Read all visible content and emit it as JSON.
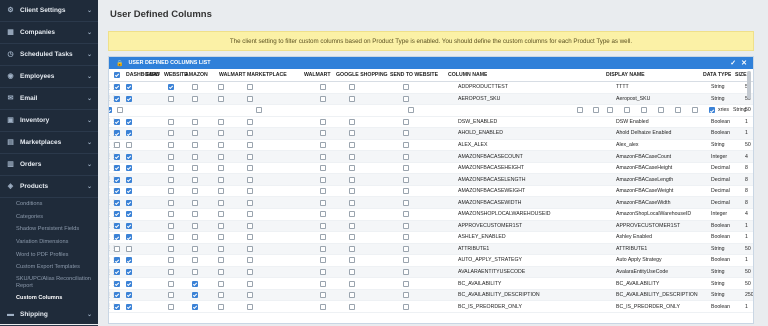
{
  "sidebar": {
    "top_items": [
      {
        "label": "Client Settings",
        "icon": "gear-icon",
        "glyph": "⚙"
      },
      {
        "label": "Companies",
        "icon": "building-icon",
        "glyph": "▦"
      },
      {
        "label": "Scheduled Tasks",
        "icon": "clock-icon",
        "glyph": "◷"
      },
      {
        "label": "Employees",
        "icon": "users-icon",
        "glyph": "◉"
      },
      {
        "label": "Email",
        "icon": "envelope-icon",
        "glyph": "✉"
      },
      {
        "label": "Inventory",
        "icon": "box-icon",
        "glyph": "▣"
      },
      {
        "label": "Marketplaces",
        "icon": "store-icon",
        "glyph": "▤"
      },
      {
        "label": "Orders",
        "icon": "cart-icon",
        "glyph": "▥"
      },
      {
        "label": "Products",
        "icon": "tag-icon",
        "glyph": "◈"
      }
    ],
    "sub_items": [
      "Conditions",
      "Categories",
      "Shadow Persistent Fields",
      "Variation Dimensions",
      "Word to PDF Profiles",
      "Custom Export Templates",
      "SKU/UPC/Alias Reconciliation Report",
      "Custom Columns"
    ],
    "bottom_item": {
      "label": "Shipping",
      "icon": "truck-icon",
      "glyph": "▬"
    }
  },
  "page": {
    "title": "User Defined Columns",
    "warning": "The client setting to filter custom columns based on Product Type is enabled. You should define the custom columns for each Product Type as well."
  },
  "panel": {
    "title": "USER DEFINED COLUMNS LIST",
    "save_glyph": "✓",
    "close_glyph": "✕",
    "lock_glyph": "🔒"
  },
  "columns": [
    "DASHBOARD",
    "EBAY",
    "WEBSITE",
    "AMAZON",
    "WALMART MARKETPLACE",
    "WALMART",
    "GOOGLE SHOPPING",
    "SEND TO WEBSITE",
    "COLUMN NAME",
    "DISPLAY NAME",
    "DATA TYPE",
    "SIZE"
  ],
  "editing_row": {
    "data_type": "xries",
    "type_label": "String",
    "size": "50"
  },
  "rows": [
    {
      "sel": true,
      "flags": [
        1,
        1,
        0,
        0,
        0,
        0,
        0,
        0
      ],
      "name": "ADDPRODUCTTEST",
      "display": "TTTT",
      "type": "String",
      "size": "50"
    },
    {
      "sel": true,
      "flags": [
        1,
        0,
        0,
        0,
        0,
        0,
        0,
        0
      ],
      "name": "AEROPOST_SKU",
      "display": "Aeropost_SKU",
      "type": "String",
      "size": "50"
    },
    {
      "sel": true,
      "flags": [
        1,
        0,
        0,
        0,
        0,
        0,
        0,
        0
      ],
      "name": "DSW_ENABLED",
      "display": "DSW Enabled",
      "type": "Boolean",
      "size": "1"
    },
    {
      "sel": true,
      "flags": [
        1,
        0,
        0,
        0,
        0,
        0,
        0,
        0
      ],
      "name": "AHOLD_ENABLED",
      "display": "Ahold Delhaize Enabled",
      "type": "Boolean",
      "size": "1"
    },
    {
      "sel": false,
      "flags": [
        0,
        0,
        0,
        0,
        0,
        0,
        0,
        0
      ],
      "name": "ALEX_ALEX",
      "display": "Alex_alex",
      "type": "String",
      "size": "50"
    },
    {
      "sel": true,
      "flags": [
        1,
        0,
        0,
        0,
        0,
        0,
        0,
        0
      ],
      "name": "AMAZONFBACASECOUNT",
      "display": "AmazonFBACaseCount",
      "type": "Integer",
      "size": "4"
    },
    {
      "sel": true,
      "flags": [
        1,
        0,
        0,
        0,
        0,
        0,
        0,
        0
      ],
      "name": "AMAZONFBACASEHEIGHT",
      "display": "AmazonFBACaseHeight",
      "type": "Decimal",
      "size": "8"
    },
    {
      "sel": true,
      "flags": [
        1,
        0,
        0,
        0,
        0,
        0,
        0,
        0
      ],
      "name": "AMAZONFBACASELENGTH",
      "display": "AmazonFBACaseLength",
      "type": "Decimal",
      "size": "8"
    },
    {
      "sel": true,
      "flags": [
        1,
        0,
        0,
        0,
        0,
        0,
        0,
        0
      ],
      "name": "AMAZONFBACASEWEIGHT",
      "display": "AmazonFBACaseWeight",
      "type": "Decimal",
      "size": "8"
    },
    {
      "sel": true,
      "flags": [
        1,
        0,
        0,
        0,
        0,
        0,
        0,
        0
      ],
      "name": "AMAZONFBACASEWIDTH",
      "display": "AmazonFBACaseWidth",
      "type": "Decimal",
      "size": "8"
    },
    {
      "sel": true,
      "flags": [
        1,
        0,
        0,
        0,
        0,
        0,
        0,
        0
      ],
      "name": "AMAZONSHOPLOCALWAREHOUSEID",
      "display": "AmazonShopLocalWarehouseID",
      "type": "Integer",
      "size": "4"
    },
    {
      "sel": true,
      "flags": [
        1,
        0,
        0,
        0,
        0,
        0,
        0,
        0
      ],
      "name": "APPROVECUSTOMER1ST",
      "display": "APPROVECUSTOMER1ST",
      "type": "Boolean",
      "size": "1"
    },
    {
      "sel": true,
      "flags": [
        1,
        0,
        0,
        0,
        0,
        0,
        0,
        0
      ],
      "name": "ASHLEY_ENABLED",
      "display": "Ashley Enabled",
      "type": "Boolean",
      "size": "1"
    },
    {
      "sel": false,
      "flags": [
        0,
        0,
        0,
        0,
        0,
        0,
        0,
        0
      ],
      "name": "ATTRIBUTE1",
      "display": "ATTRIBUTE1",
      "type": "String",
      "size": "50"
    },
    {
      "sel": true,
      "flags": [
        1,
        0,
        0,
        0,
        0,
        0,
        0,
        0
      ],
      "name": "AUTO_APPLY_STRATEGY",
      "display": "Auto Apply Strategy",
      "type": "Boolean",
      "size": "1"
    },
    {
      "sel": true,
      "flags": [
        1,
        0,
        0,
        0,
        0,
        0,
        0,
        0
      ],
      "name": "AVALARAENTITYUSECODE",
      "display": "AvalaraEntityUseCode",
      "type": "String",
      "size": "50"
    },
    {
      "sel": true,
      "flags": [
        1,
        0,
        1,
        0,
        0,
        0,
        0,
        0
      ],
      "name": "BC_AVAILABILITY",
      "display": "BC_AVAILABILITY",
      "type": "String",
      "size": "50"
    },
    {
      "sel": true,
      "flags": [
        1,
        0,
        1,
        0,
        0,
        0,
        0,
        0
      ],
      "name": "BC_AVAILABILITY_DESCRIPTION",
      "display": "BC_AVAILABILITY_DESCRIPTION",
      "type": "String",
      "size": "250"
    },
    {
      "sel": true,
      "flags": [
        1,
        0,
        1,
        0,
        0,
        0,
        0,
        0
      ],
      "name": "BC_IS_PREORDER_ONLY",
      "display": "BC_IS_PREORDER_ONLY",
      "type": "Boolean",
      "size": "1"
    }
  ]
}
